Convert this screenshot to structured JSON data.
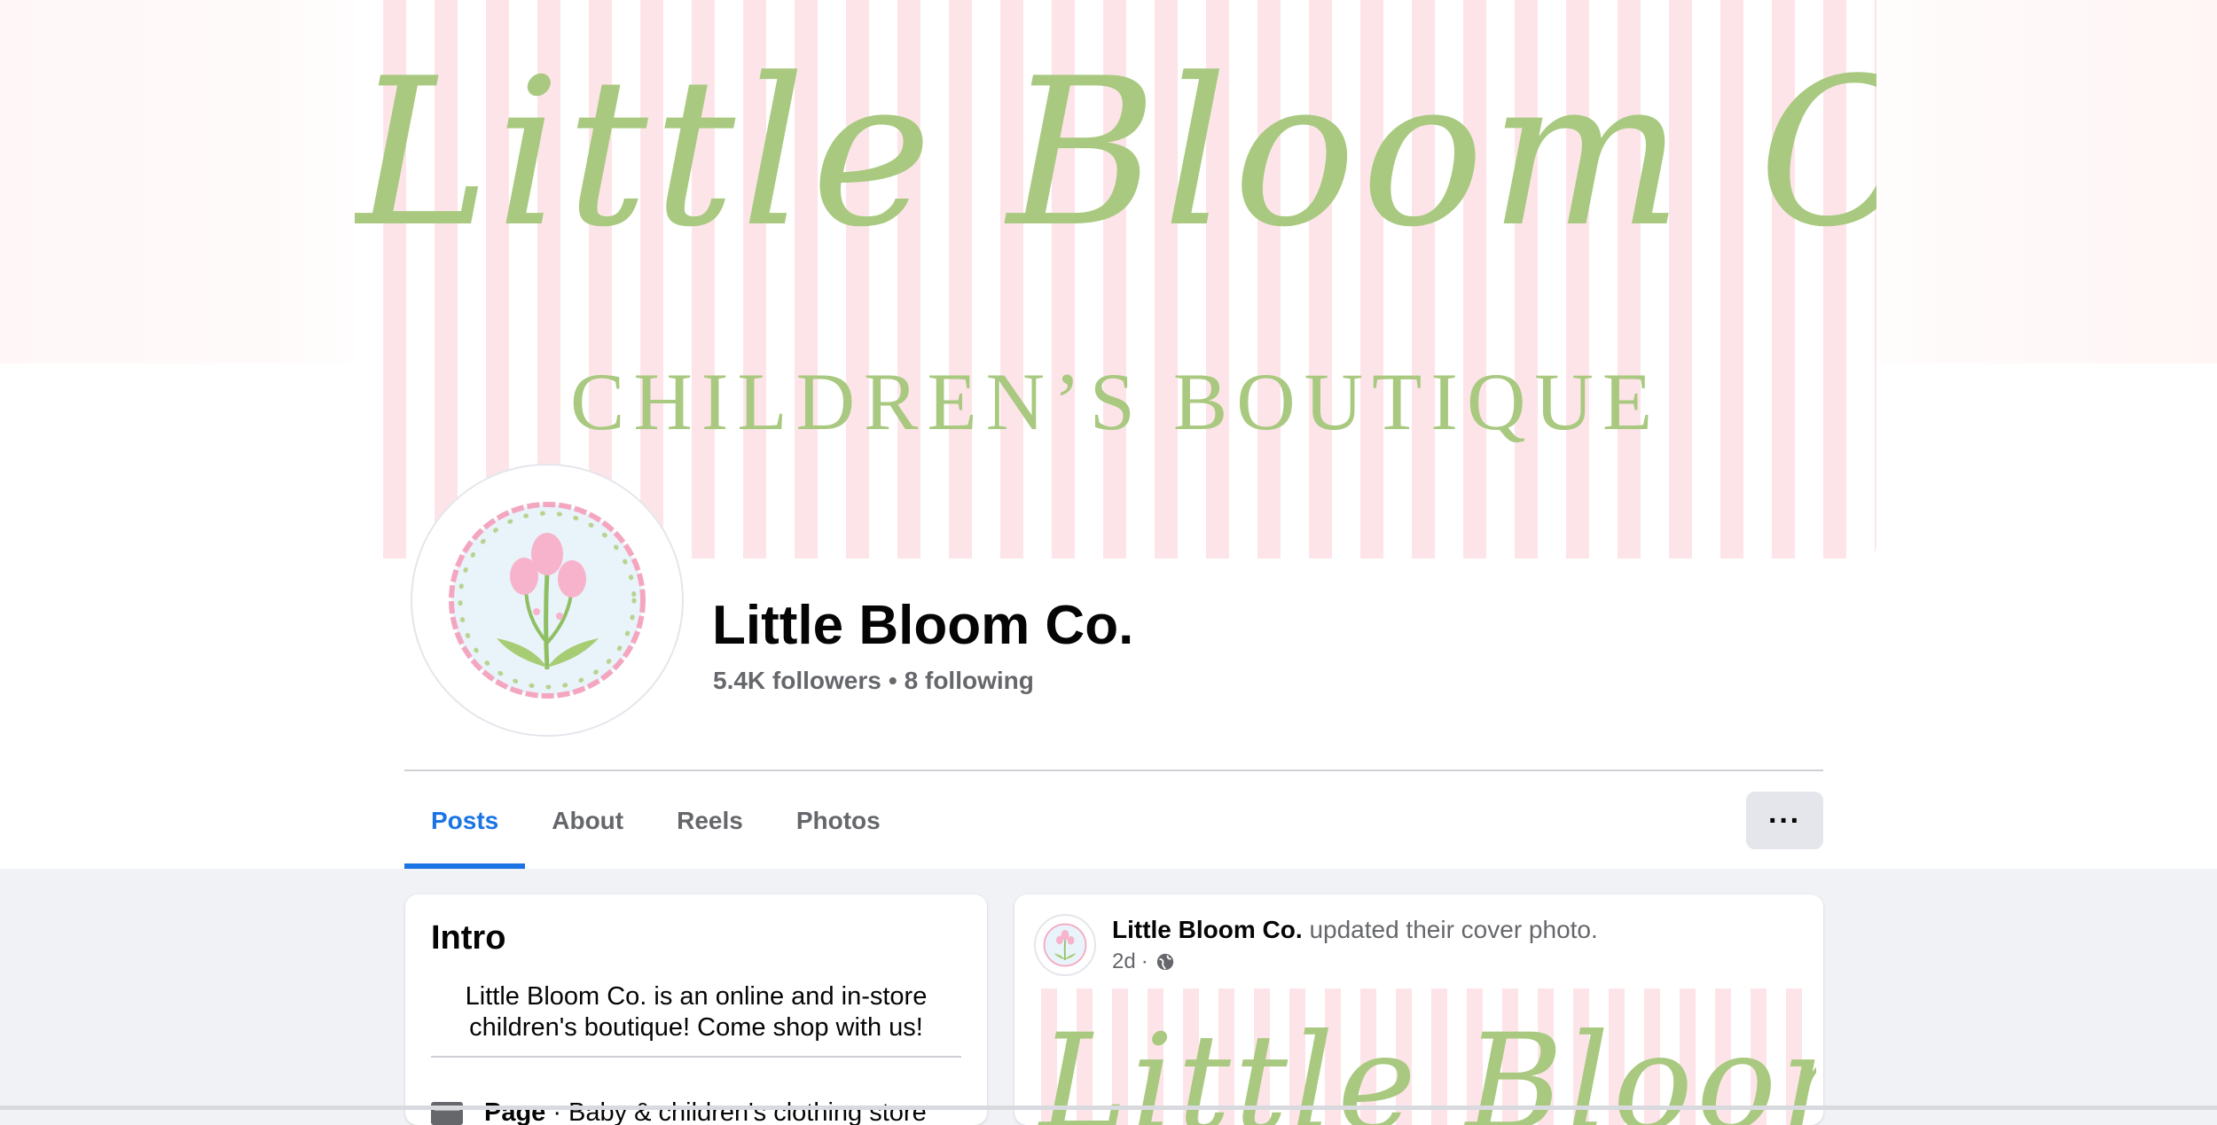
{
  "cover": {
    "script_text": "Little Bloom Co.",
    "subtitle": "CHILDREN’S BOUTIQUE",
    "stripe_color": "#fde4e8",
    "text_color": "#a8c97f"
  },
  "profile": {
    "name": "Little Bloom Co.",
    "followers": "5.4K followers",
    "separator": "•",
    "following": "8 following"
  },
  "tabs": [
    {
      "label": "Posts",
      "active": true
    },
    {
      "label": "About",
      "active": false
    },
    {
      "label": "Reels",
      "active": false
    },
    {
      "label": "Photos",
      "active": false
    }
  ],
  "more_button": {
    "label": "···",
    "icon": "more-horizontal-icon"
  },
  "intro": {
    "title": "Intro",
    "bio": "Little Bloom Co. is an online and in-store children's boutique! Come shop with us!",
    "category_label": "Page",
    "category_separator": "·",
    "category_value": "Baby & children's clothing store",
    "category_icon": "page-flag-icon"
  },
  "post": {
    "author": "Little Bloom Co.",
    "action": "updated their cover photo.",
    "time": "2d",
    "time_separator": "·",
    "audience_icon": "globe-icon",
    "image_script": "Little Bloom Co."
  },
  "colors": {
    "accent": "#1b74e4",
    "secondary_text": "#65676b",
    "page_bg": "#f0f2f5"
  }
}
